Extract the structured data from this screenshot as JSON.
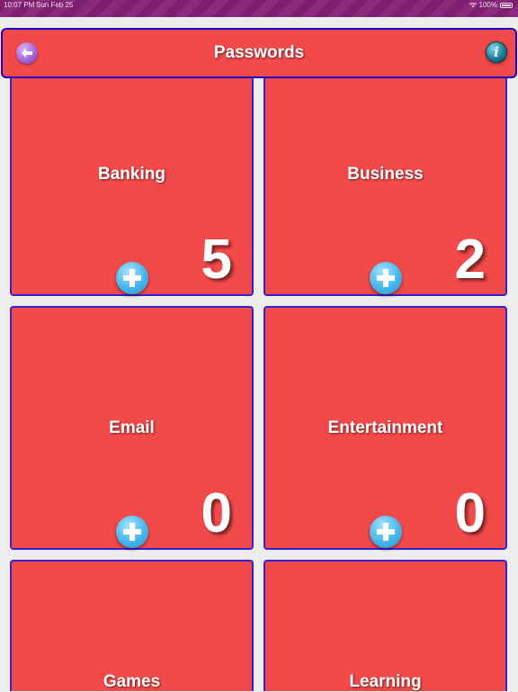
{
  "status_bar": {
    "time": "10:07 PM",
    "date": "Sun Feb 25",
    "battery": "100%"
  },
  "header": {
    "title": "Passwords",
    "back_icon": "back-arrow-icon",
    "info_icon": "info-icon",
    "info_glyph": "i"
  },
  "colors": {
    "tile_fill": "#f2494a",
    "tile_border": "#3a1fd0",
    "status_bar": "#7d1e6f",
    "background": "#ededed",
    "add_button": "#46b6ec"
  },
  "categories": [
    {
      "label": "Banking",
      "count": "5"
    },
    {
      "label": "Business",
      "count": "2"
    },
    {
      "label": "Email",
      "count": "0"
    },
    {
      "label": "Entertainment",
      "count": "0"
    },
    {
      "label": "Games",
      "count": ""
    },
    {
      "label": "Learning",
      "count": ""
    }
  ]
}
